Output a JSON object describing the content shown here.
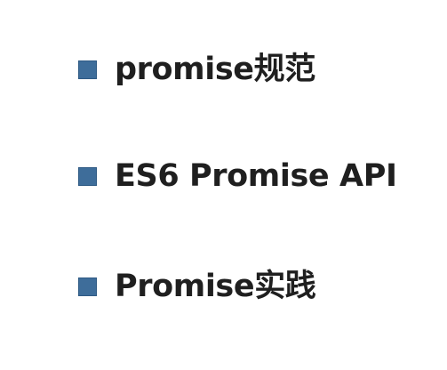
{
  "slide": {
    "bullets": [
      {
        "label": "promise规范"
      },
      {
        "label": "ES6 Promise API"
      },
      {
        "label": "Promise实践"
      }
    ]
  },
  "colors": {
    "bullet": "#3e6d9a",
    "text": "#1f1f1f",
    "background": "#ffffff"
  },
  "icons": {
    "bullet": "square-bullet-icon"
  }
}
